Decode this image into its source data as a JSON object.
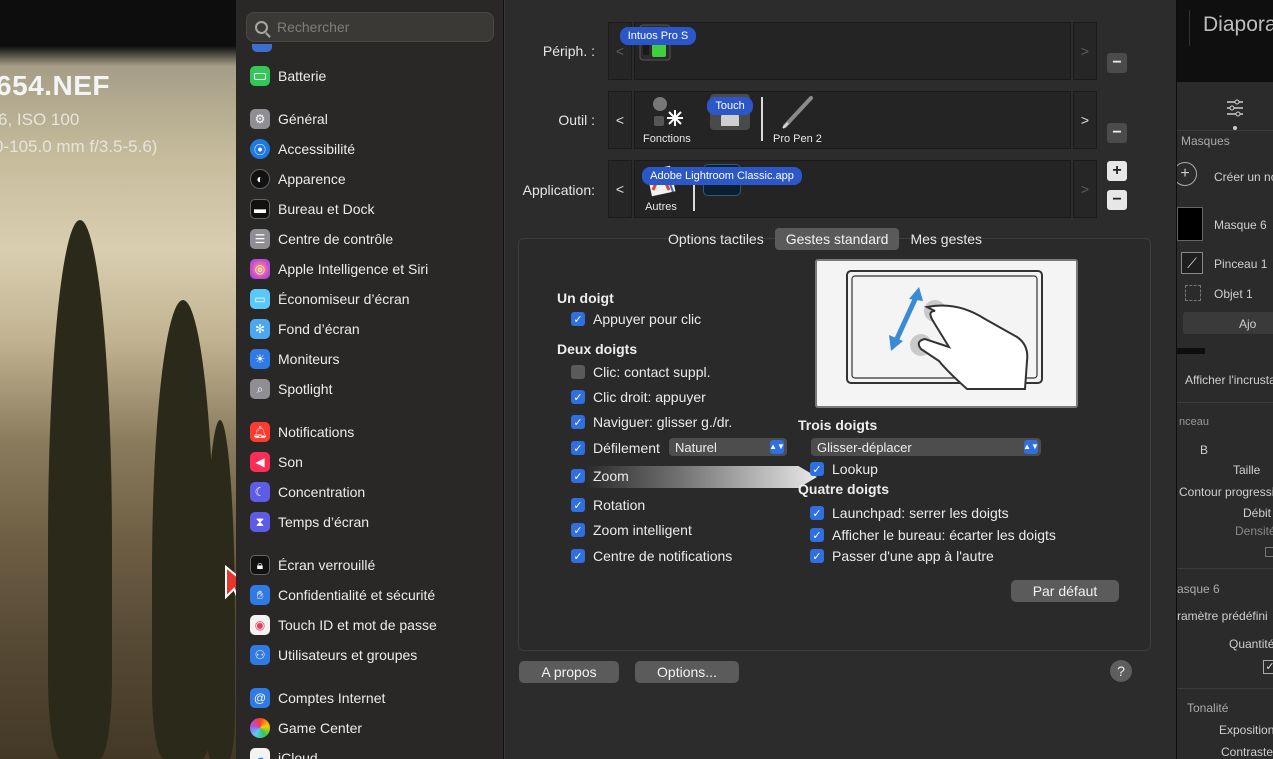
{
  "photo": {
    "title": "654.NEF",
    "line1": "6, ISO 100",
    "line2": "0-105.0 mm f/3.5-5.6)"
  },
  "sidebar": {
    "search_placeholder": "Rechercher",
    "items": [
      {
        "label": "Batterie",
        "icon": "battery-icon",
        "color": "#34c759"
      },
      {
        "label": "Général",
        "icon": "gear-icon",
        "color": "#8e8e93"
      },
      {
        "label": "Accessibilité",
        "icon": "accessibility-icon",
        "color": "#1f7ae0"
      },
      {
        "label": "Apparence",
        "icon": "appearance-icon",
        "color": "#111111"
      },
      {
        "label": "Bureau et Dock",
        "icon": "dock-icon",
        "color": "#111111"
      },
      {
        "label": "Centre de contrôle",
        "icon": "control-center-icon",
        "color": "#8e8e93"
      },
      {
        "label": "Apple Intelligence et Siri",
        "icon": "siri-icon",
        "color": "#d34bd0"
      },
      {
        "label": "Économiseur d’écran",
        "icon": "screensaver-icon",
        "color": "#5ac8fa"
      },
      {
        "label": "Fond d’écran",
        "icon": "wallpaper-icon",
        "color": "#4aa8f0"
      },
      {
        "label": "Moniteurs",
        "icon": "displays-icon",
        "color": "#2f7ae5"
      },
      {
        "label": "Spotlight",
        "icon": "spotlight-icon",
        "color": "#8e8e93"
      },
      {
        "label": "Notifications",
        "icon": "notifications-icon",
        "color": "#ff3b30"
      },
      {
        "label": "Son",
        "icon": "sound-icon",
        "color": "#ff2d55"
      },
      {
        "label": "Concentration",
        "icon": "focus-icon",
        "color": "#5e5ce6"
      },
      {
        "label": "Temps d’écran",
        "icon": "screen-time-icon",
        "color": "#5e5ce6"
      },
      {
        "label": "Écran verrouillé",
        "icon": "lock-screen-icon",
        "color": "#111111"
      },
      {
        "label": "Confidentialité et sécurité",
        "icon": "privacy-hand-icon",
        "color": "#2f7ae5"
      },
      {
        "label": "Touch ID et mot de passe",
        "icon": "fingerprint-icon",
        "color": "#f3f3f3"
      },
      {
        "label": "Utilisateurs et groupes",
        "icon": "users-icon",
        "color": "#2f7ae5"
      },
      {
        "label": "Comptes Internet",
        "icon": "at-icon",
        "color": "#2f7ae5"
      },
      {
        "label": "Game Center",
        "icon": "game-center-icon",
        "color": "#f3f3f3"
      },
      {
        "label": "iCloud",
        "icon": "icloud-icon",
        "color": "#f3f3f3"
      }
    ]
  },
  "main": {
    "peripherals_label": "Périph. :",
    "tool_label": "Outil :",
    "application_label": "Application:",
    "device_name": "Intuos Pro S",
    "tools": [
      {
        "label": "Fonctions",
        "icon": "functions-icon",
        "selected": false
      },
      {
        "label": "Touch",
        "icon": "touch-icon",
        "selected": true
      },
      {
        "label": "Pro Pen 2",
        "icon": "pen-icon",
        "selected": false
      }
    ],
    "apps": [
      {
        "label": "Autres",
        "icon": "other-apps-icon",
        "selected": false
      },
      {
        "label": "Adobe Lightroom Classic.app",
        "icon_text": "LrC",
        "selected": true
      }
    ],
    "arrow_left": "<",
    "arrow_right": ">",
    "minus": "−",
    "plus": "+",
    "tabs": [
      {
        "label": "Options tactiles",
        "active": false
      },
      {
        "label": "Gestes standard",
        "active": true
      },
      {
        "label": "Mes gestes",
        "active": false
      }
    ],
    "one_finger": {
      "title": "Un doigt",
      "items": [
        {
          "label": "Appuyer pour clic",
          "checked": true
        }
      ]
    },
    "two_fingers": {
      "title": "Deux doigts",
      "items": [
        {
          "label": "Clic: contact suppl.",
          "checked": false
        },
        {
          "label": "Clic droit: appuyer",
          "checked": true
        },
        {
          "label": "Naviguer: glisser g./dr.",
          "checked": true
        },
        {
          "label": "Défilement",
          "checked": true
        },
        {
          "label": "Zoom",
          "checked": true
        },
        {
          "label": "Rotation",
          "checked": true
        },
        {
          "label": "Zoom intelligent",
          "checked": true
        },
        {
          "label": "Centre de notifications",
          "checked": true
        }
      ],
      "scroll_select": "Naturel"
    },
    "three_fingers": {
      "title": "Trois doigts",
      "select": "Glisser-déplacer",
      "items": [
        {
          "label": "Lookup",
          "checked": true
        }
      ]
    },
    "four_fingers": {
      "title": "Quatre doigts",
      "items": [
        {
          "label": "Launchpad: serrer les doigts",
          "checked": true
        },
        {
          "label": "Afficher le bureau: écarter les doigts",
          "checked": true
        },
        {
          "label": "Passer d'une app à l'autre",
          "checked": true
        }
      ]
    },
    "default_button": "Par défaut",
    "about_button": "A propos",
    "options_button": "Options...",
    "help": "?"
  },
  "lightroom": {
    "title": "Diapora",
    "masks": "Masques",
    "create": "Créer un no",
    "mask6": "Masque 6",
    "brush": "Pinceau 1",
    "object": "Objet 1",
    "add": "Ajo",
    "overlay": "Afficher l'incrusta",
    "brush_section": "nceau",
    "b": "B",
    "size": "Taille",
    "feather": "Contour progressif",
    "flow": "Débit",
    "density": "Densité",
    "mask6b": "asque 6",
    "preset": "ramètre prédéfini",
    "amount": "Quantité",
    "tone": "Tonalité",
    "exposure": "Exposition",
    "contrast": "Contraste"
  }
}
